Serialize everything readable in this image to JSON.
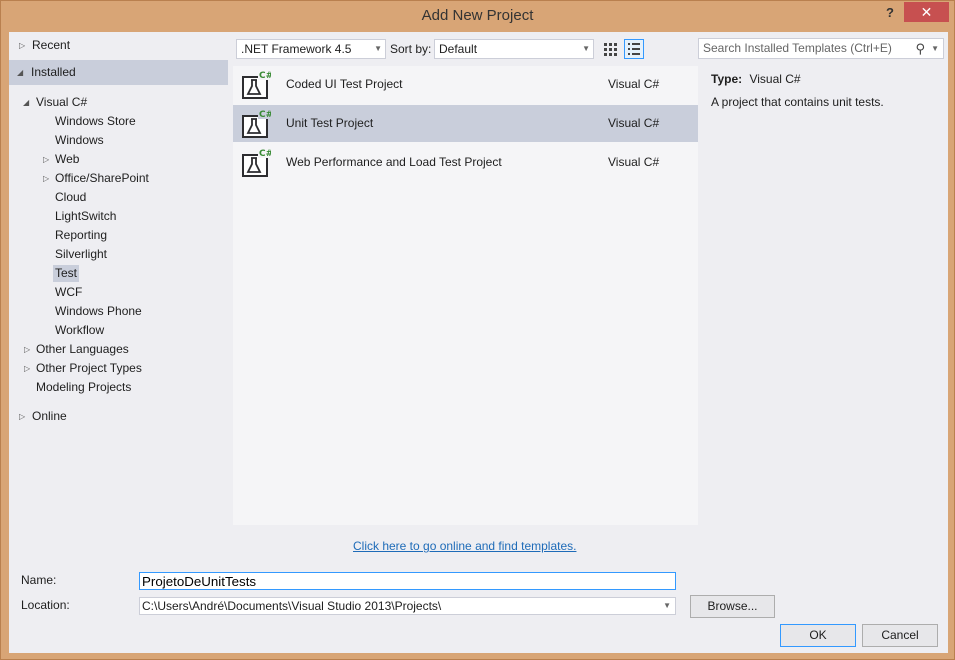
{
  "window": {
    "title": "Add New Project",
    "help": "?",
    "close": "✕"
  },
  "tree": {
    "recent": "Recent",
    "installed": "Installed",
    "visual_csharp": "Visual C#",
    "children": [
      "Windows Store",
      "Windows",
      "Web",
      "Office/SharePoint",
      "Cloud",
      "LightSwitch",
      "Reporting",
      "Silverlight",
      "Test",
      "WCF",
      "Windows Phone",
      "Workflow"
    ],
    "other_languages": "Other Languages",
    "other_project_types": "Other Project Types",
    "modeling_projects": "Modeling Projects",
    "online": "Online"
  },
  "toolbar": {
    "framework": ".NET Framework 4.5",
    "sort_label": "Sort by:",
    "sort_value": "Default",
    "search_placeholder": "Search Installed Templates (Ctrl+E)"
  },
  "templates": [
    {
      "name": "Coded UI Test Project",
      "lang": "Visual C#",
      "selected": false
    },
    {
      "name": "Unit Test Project",
      "lang": "Visual C#",
      "selected": true
    },
    {
      "name": "Web Performance and Load Test Project",
      "lang": "Visual C#",
      "selected": false
    }
  ],
  "info": {
    "type_label": "Type:",
    "type_value": "Visual C#",
    "description": "A project that contains unit tests."
  },
  "online_link": "Click here to go online and find templates.",
  "form": {
    "name_label": "Name:",
    "name_value": "ProjetoDeUnitTests",
    "location_label": "Location:",
    "location_value": "C:\\Users\\André\\Documents\\Visual Studio 2013\\Projects\\",
    "browse": "Browse...",
    "ok": "OK",
    "cancel": "Cancel"
  },
  "colors": {
    "selection": "#c9cedb",
    "accent": "#3399ff",
    "link": "#1e6bb8",
    "frame": "#d8a576",
    "close": "#c75050"
  }
}
